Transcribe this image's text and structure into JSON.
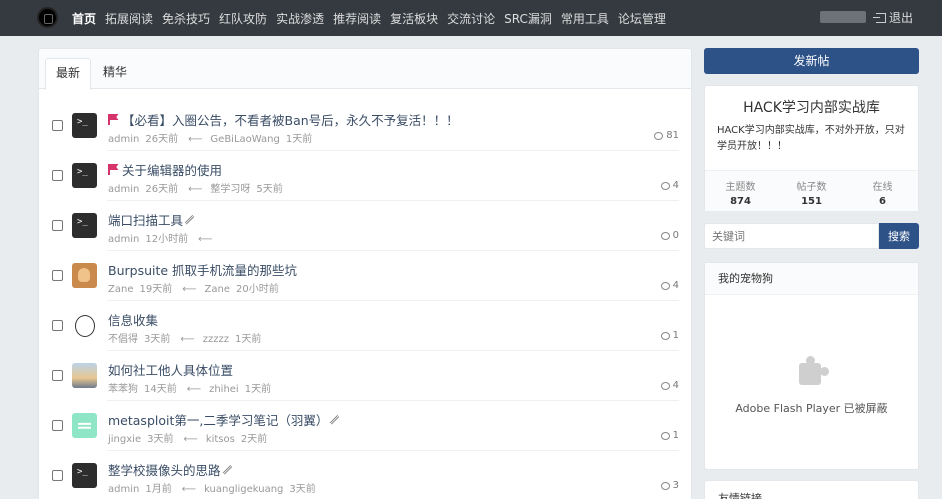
{
  "nav": {
    "items": [
      "首页",
      "拓展阅读",
      "免杀技巧",
      "红队攻防",
      "实战渗透",
      "推荐阅读",
      "复活板块",
      "交流讨论",
      "SRC漏洞",
      "常用工具",
      "论坛管理"
    ],
    "logout": "退出"
  },
  "tabs": [
    "最新",
    "精华"
  ],
  "threads": [
    {
      "title": "【必看】入圈公告，不看者被Ban号后，永久不予复活！！！",
      "flag": true,
      "clip": false,
      "author": "admin",
      "age": "26天前",
      "last_user": "GeBiLaoWang",
      "last_time": "1天前",
      "replies": "81",
      "avatar": "terminal"
    },
    {
      "title": "关于编辑器的使用",
      "flag": true,
      "clip": false,
      "author": "admin",
      "age": "26天前",
      "last_user": "整学习呀",
      "last_time": "5天前",
      "replies": "4",
      "avatar": "terminal"
    },
    {
      "title": "端口扫描工具",
      "flag": false,
      "clip": true,
      "author": "admin",
      "age": "12小时前",
      "last_user": "",
      "last_time": "",
      "replies": "0",
      "avatar": "terminal"
    },
    {
      "title": "Burpsuite 抓取手机流量的那些坑",
      "flag": false,
      "clip": false,
      "author": "Zane",
      "age": "19天前",
      "last_user": "Zane",
      "last_time": "20小时前",
      "replies": "4",
      "avatar": "dog"
    },
    {
      "title": "信息收集",
      "flag": false,
      "clip": false,
      "author": "不倡得",
      "age": "3天前",
      "last_user": "zzzzz",
      "last_time": "1天前",
      "replies": "1",
      "avatar": "face"
    },
    {
      "title": "如何社工他人具体位置",
      "flag": false,
      "clip": false,
      "author": "苯苯狗",
      "age": "14天前",
      "last_user": "zhihei",
      "last_time": "1天前",
      "replies": "4",
      "avatar": "sky"
    },
    {
      "title": "metasploit第一,二季学习笔记（羽翼）",
      "flag": false,
      "clip": true,
      "author": "jingxie",
      "age": "3天前",
      "last_user": "kitsos",
      "last_time": "2天前",
      "replies": "1",
      "avatar": "mint"
    },
    {
      "title": "整学校摄像头的思路",
      "flag": false,
      "clip": true,
      "author": "admin",
      "age": "1月前",
      "last_user": "kuangligekuang",
      "last_time": "3天前",
      "replies": "3",
      "avatar": "terminal"
    }
  ],
  "sidebar": {
    "new_post": "发新帖",
    "forum_title": "HACK学习内部实战库",
    "forum_desc": "HACK学习内部实战库，不对外开放，只对学员开放！！！",
    "stats": [
      {
        "label": "主题数",
        "value": "874"
      },
      {
        "label": "帖子数",
        "value": "151"
      },
      {
        "label": "在线",
        "value": "6"
      }
    ],
    "search_placeholder": "关键词",
    "search_button": "搜索",
    "pet_title": "我的宠物狗",
    "flash_text": "Adobe Flash Player 已被屏蔽",
    "friends_title": "友情链接"
  },
  "colors": {
    "topbar": "#343a40",
    "accent": "#2d5288",
    "flag": "#d6336c"
  }
}
